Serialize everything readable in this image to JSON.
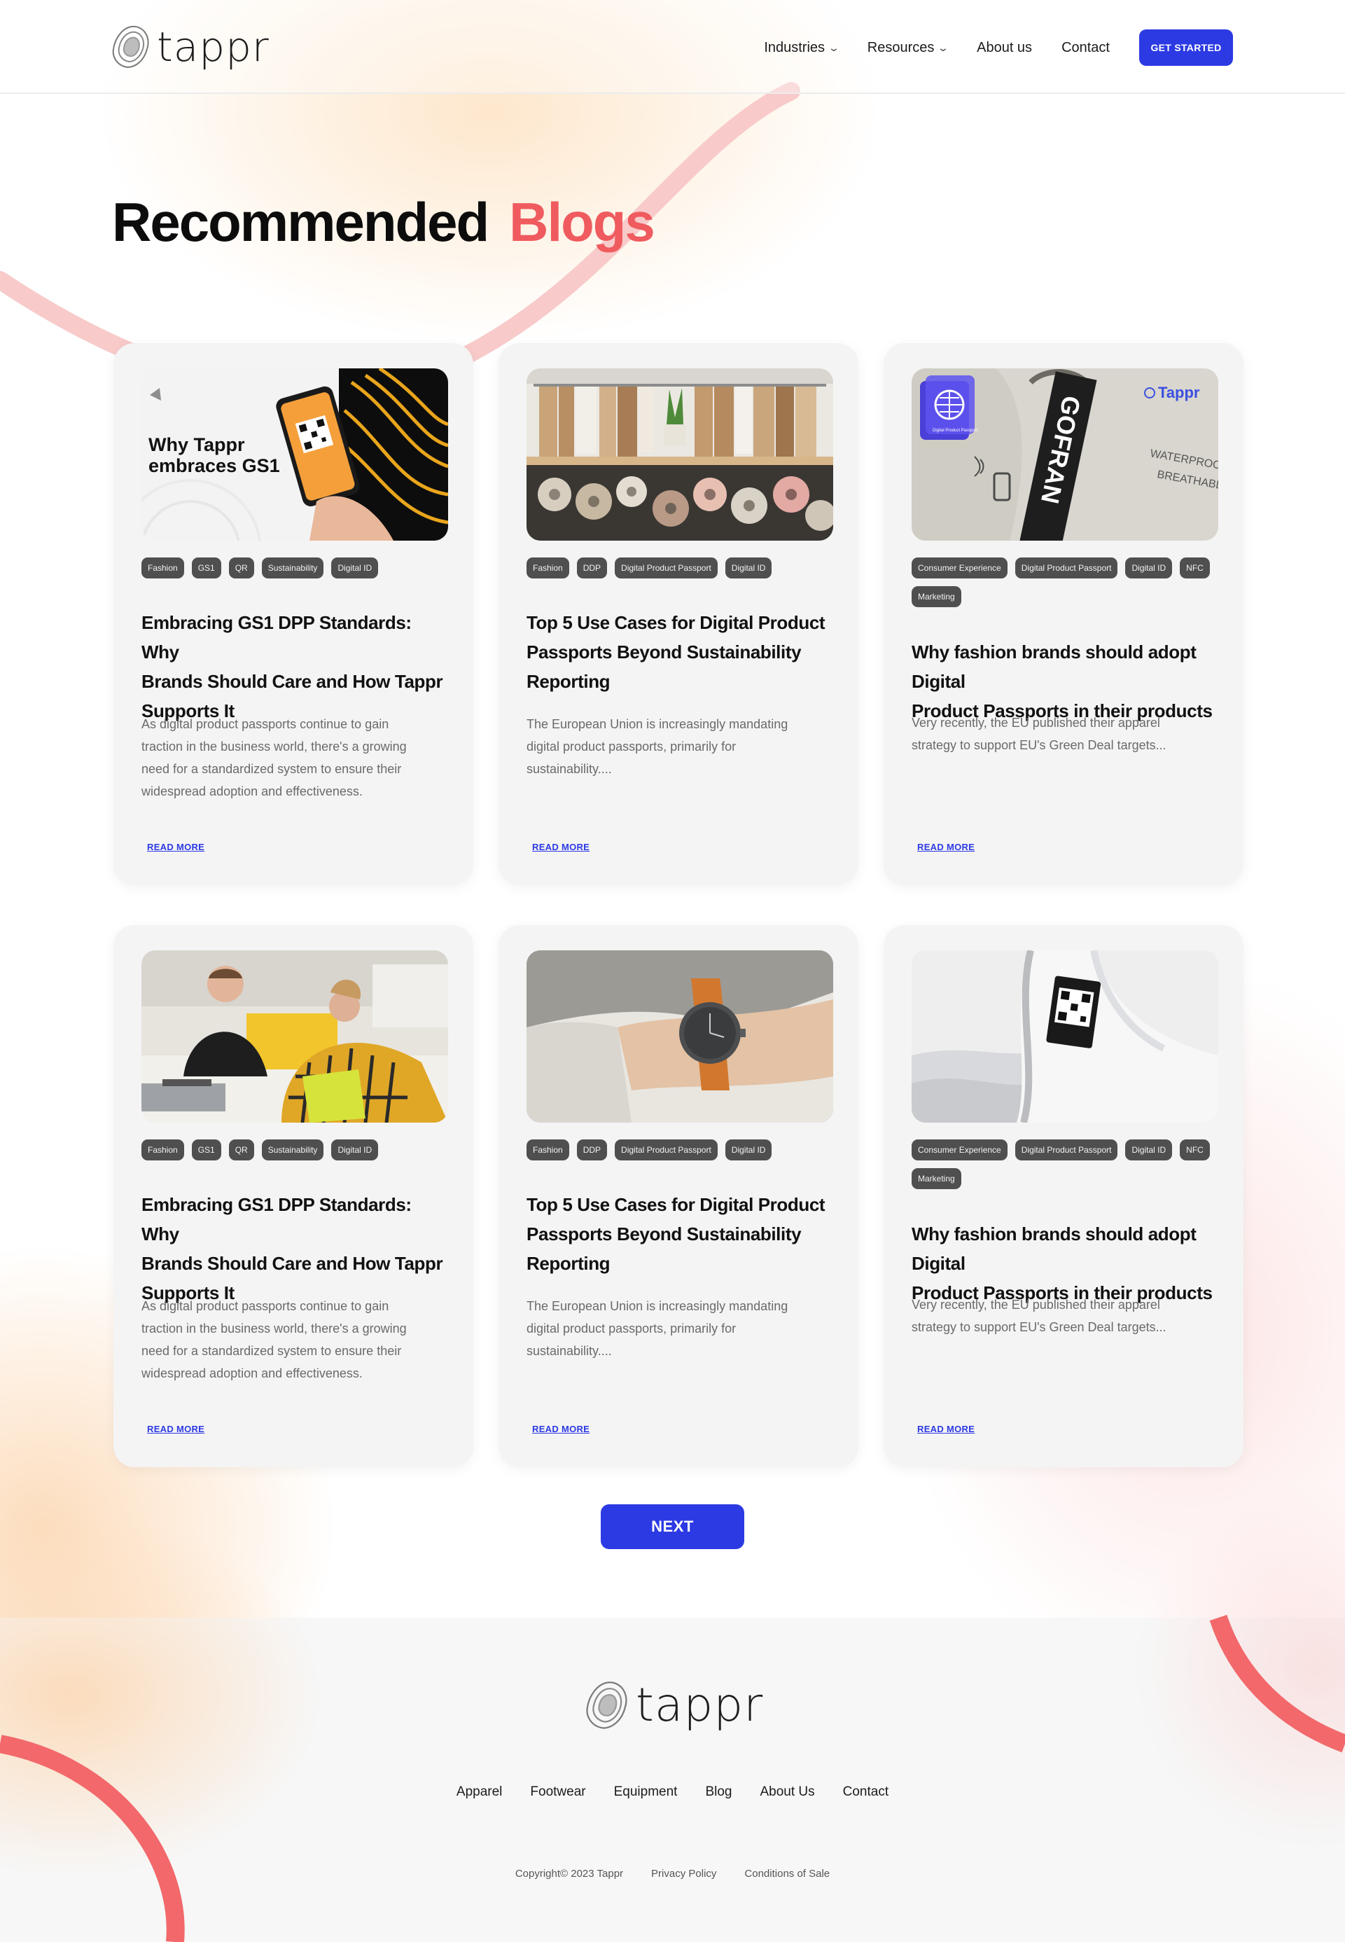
{
  "brand": {
    "name": "tappr"
  },
  "colors": {
    "accent": "#2c3ae3",
    "highlight": "#ef5b5e",
    "tag_bg": "#4f4f4f",
    "card_bg": "#f4f4f4"
  },
  "nav": {
    "items": [
      {
        "label": "Industries",
        "dropdown": true
      },
      {
        "label": "Resources",
        "dropdown": true
      },
      {
        "label": "About us",
        "dropdown": false
      },
      {
        "label": "Contact",
        "dropdown": false
      }
    ],
    "cta": "GET STARTED"
  },
  "section": {
    "title_part1": "Recommended",
    "title_part2": "Blogs"
  },
  "cards": [
    {
      "image": "GS1 promo graphic with phone showing QR code",
      "image_text": [
        "Why Tappr",
        "embraces GS1"
      ],
      "tags": [
        "Fashion",
        "GS1",
        "QR",
        "Sustainability",
        "Digital ID"
      ],
      "title": [
        "Embracing GS1 DPP Standards: Why",
        "Brands Should Care and How Tappr",
        "Supports It"
      ],
      "desc": [
        "As digital product passports continue to gain",
        "traction in the business world, there's a growing",
        "need for a standardized system to ensure their",
        "widespread adoption and effectiveness."
      ],
      "read_more": "READ MORE"
    },
    {
      "image": "Garment rack with fabric rolls",
      "tags": [
        "Fashion",
        "DDP",
        "Digital Product Passport",
        "Digital ID"
      ],
      "title": [
        "Top 5 Use Cases for Digital Product",
        "Passports Beyond Sustainability",
        "Reporting"
      ],
      "desc": [
        "The European Union is increasingly mandating",
        "digital product passports, primarily for",
        "sustainability...."
      ],
      "read_more": "READ MORE"
    },
    {
      "image": "Jacket label with digital product passport tag",
      "image_text": [
        "GOFRAN",
        "Tappr",
        "WATERPROOF",
        "BREATHABLE",
        "Digital Product Passport"
      ],
      "tags": [
        "Consumer Experience",
        "Digital Product Passport",
        "Digital ID",
        "NFC",
        "Marketing"
      ],
      "title": [
        "Why fashion brands should adopt Digital",
        "Product Passports in their products"
      ],
      "desc": [
        "Very recently, the EU published their apparel",
        "strategy to support EU's Green Deal targets..."
      ],
      "read_more": "READ MORE"
    },
    {
      "image": "Two people laughing at laptops",
      "tags": [
        "Fashion",
        "GS1",
        "QR",
        "Sustainability",
        "Digital ID"
      ],
      "title": [
        "Embracing GS1 DPP Standards: Why",
        "Brands Should Care and How Tappr",
        "Supports It"
      ],
      "desc": [
        "As digital product passports continue to gain",
        "traction in the business world, there's a growing",
        "need for a standardized system to ensure their",
        "widespread adoption and effectiveness."
      ],
      "read_more": "READ MORE"
    },
    {
      "image": "Wrist watch with orange strap",
      "tags": [
        "Fashion",
        "DDP",
        "Digital Product Passport",
        "Digital ID"
      ],
      "title": [
        "Top 5 Use Cases for Digital Product",
        "Passports Beyond Sustainability",
        "Reporting"
      ],
      "desc": [
        "The European Union is increasingly mandating",
        "digital product passports, primarily for",
        "sustainability...."
      ],
      "read_more": "READ MORE"
    },
    {
      "image": "White garment with QR code label",
      "tags": [
        "Consumer Experience",
        "Digital Product Passport",
        "Digital ID",
        "NFC",
        "Marketing"
      ],
      "title": [
        "Why fashion brands should adopt Digital",
        "Product Passports in their products"
      ],
      "desc": [
        "Very recently, the EU published their apparel",
        "strategy to support EU's Green Deal targets..."
      ],
      "read_more": "READ MORE"
    }
  ],
  "pagination": {
    "next": "NEXT"
  },
  "footer": {
    "links": [
      "Apparel",
      "Footwear",
      "Equipment",
      "Blog",
      "About Us",
      "Contact"
    ],
    "copyright": "Copyright© 2023 Tappr",
    "legal": [
      "Privacy Policy",
      "Conditions of Sale"
    ]
  }
}
